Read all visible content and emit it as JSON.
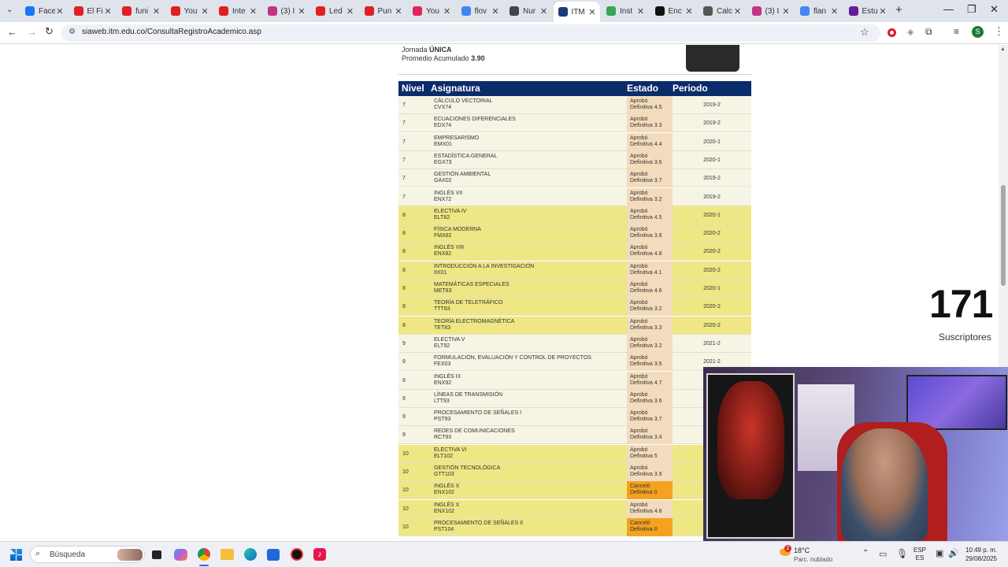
{
  "browser": {
    "tabs": [
      {
        "label": "Face",
        "color": "#1877f2"
      },
      {
        "label": "El Fi",
        "color": "#e02020"
      },
      {
        "label": "funi",
        "color": "#e02020"
      },
      {
        "label": "You",
        "color": "#e02020"
      },
      {
        "label": "Inte",
        "color": "#e02020"
      },
      {
        "label": "(3) I",
        "color": "#c13584"
      },
      {
        "label": "Led",
        "color": "#e02020"
      },
      {
        "label": "Pun",
        "color": "#e02020"
      },
      {
        "label": "You",
        "color": "#e0245e"
      },
      {
        "label": "flov",
        "color": "#4285f4"
      },
      {
        "label": "Nur",
        "color": "#444444"
      },
      {
        "label": "ITM",
        "color": "#1a3d7a"
      },
      {
        "label": "Inst",
        "color": "#34a853"
      },
      {
        "label": "Enc",
        "color": "#111111"
      },
      {
        "label": "Calc",
        "color": "#555555"
      },
      {
        "label": "(3) I",
        "color": "#c13584"
      },
      {
        "label": "flan",
        "color": "#4285f4"
      },
      {
        "label": "Estu",
        "color": "#6a1b9a"
      }
    ],
    "new_tab": "+",
    "minimize": "—",
    "restore": "❐",
    "close": "✕",
    "url": "siaweb.itm.edu.co/ConsultaRegistroAcademico.asp",
    "profile_initial": "S"
  },
  "student": {
    "jornada_label": "Jornada",
    "jornada_value": "ÚNICA",
    "promedio_label": "Promedio Acumulado",
    "promedio_value": "3.90"
  },
  "table": {
    "headers": {
      "nivel": "Nivel",
      "asignatura": "Asignatura",
      "estado": "Estado",
      "periodo": "Periodo"
    },
    "rows": [
      {
        "nivel": "7",
        "name": "CÁLCULO VECTORIAL",
        "code": "CVX74",
        "estado": "Aprobó",
        "nota": "Definitiva 4.5",
        "periodo": "2019-2",
        "status": "ok"
      },
      {
        "nivel": "7",
        "name": "ECUACIONES DIFERENCIALES",
        "code": "EDX74",
        "estado": "Aprobó",
        "nota": "Definitiva 3.3",
        "periodo": "2019-2",
        "status": "ok"
      },
      {
        "nivel": "7",
        "name": "EMPRESARISMO",
        "code": "EMX01",
        "estado": "Aprobó",
        "nota": "Definitiva 4.4",
        "periodo": "2020-1",
        "status": "ok"
      },
      {
        "nivel": "7",
        "name": "ESTADÍSTICA GENERAL",
        "code": "EGX73",
        "estado": "Aprobó",
        "nota": "Definitiva 3.6",
        "periodo": "2020-1",
        "status": "ok"
      },
      {
        "nivel": "7",
        "name": "GESTIÓN AMBIENTAL",
        "code": "GAX02",
        "estado": "Aprobó",
        "nota": "Definitiva 3.7",
        "periodo": "2019-2",
        "status": "ok"
      },
      {
        "nivel": "7",
        "name": "INGLÉS VII",
        "code": "ENX72",
        "estado": "Aprobó",
        "nota": "Definitiva 3.2",
        "periodo": "2019-2",
        "status": "ok"
      },
      {
        "nivel": "8",
        "name": "ELECTIVA IV",
        "code": "ELT82",
        "estado": "Aprobó",
        "nota": "Definitiva 4.5",
        "periodo": "2020-1",
        "status": "ok"
      },
      {
        "nivel": "8",
        "name": "FÍSICA MODERNA",
        "code": "FMX82",
        "estado": "Aprobó",
        "nota": "Definitiva 3.8",
        "periodo": "2020-2",
        "status": "ok"
      },
      {
        "nivel": "8",
        "name": "INGLÉS VIII",
        "code": "ENX82",
        "estado": "Aprobó",
        "nota": "Definitiva 4.8",
        "periodo": "2020-2",
        "status": "ok"
      },
      {
        "nivel": "8",
        "name": "INTRODUCCIÓN A LA INVESTIGACIÓN",
        "code": "IIX01",
        "estado": "Aprobó",
        "nota": "Definitiva 4.1",
        "periodo": "2020-2",
        "status": "ok"
      },
      {
        "nivel": "8",
        "name": "MATEMÁTICAS ESPECIALES",
        "code": "MET83",
        "estado": "Aprobó",
        "nota": "Definitiva 4.6",
        "periodo": "2020-1",
        "status": "ok"
      },
      {
        "nivel": "8",
        "name": "TEORÍA DE TELETRÁFICO",
        "code": "TTT83",
        "estado": "Aprobó",
        "nota": "Definitiva 3.2",
        "periodo": "2020-2",
        "status": "ok"
      },
      {
        "nivel": "8",
        "name": "TEORÍA ELECTROMAGNÉTICA",
        "code": "TET83",
        "estado": "Aprobó",
        "nota": "Definitiva 3.3",
        "periodo": "2020-2",
        "status": "ok"
      },
      {
        "nivel": "9",
        "name": "ELECTIVA V",
        "code": "ELT92",
        "estado": "Aprobó",
        "nota": "Definitiva 3.2",
        "periodo": "2021-2",
        "status": "ok"
      },
      {
        "nivel": "9",
        "name": "FORMULACIÓN, EVALUACIÓN Y CONTROL DE PROYECTOS",
        "code": "FEX03",
        "estado": "Aprobó",
        "nota": "Definitiva 3.5",
        "periodo": "2021-2",
        "status": "ok"
      },
      {
        "nivel": "9",
        "name": "INGLÉS IX",
        "code": "ENX92",
        "estado": "Aprobó",
        "nota": "Definitiva 4.7",
        "periodo": "",
        "status": "ok"
      },
      {
        "nivel": "9",
        "name": "LÍNEAS DE TRANSMISIÓN",
        "code": "LTT93",
        "estado": "Aprobó",
        "nota": "Definitiva 3.6",
        "periodo": "",
        "status": "ok"
      },
      {
        "nivel": "9",
        "name": "PROCESAMIENTO DE SEÑALES I",
        "code": "PST93",
        "estado": "Aprobó",
        "nota": "Definitiva 3.7",
        "periodo": "",
        "status": "ok"
      },
      {
        "nivel": "9",
        "name": "REDES DE COMUNICACIONES",
        "code": "RCT93",
        "estado": "Aprobó",
        "nota": "Definitiva 3.4",
        "periodo": "",
        "status": "ok"
      },
      {
        "nivel": "10",
        "name": "ELECTIVA VI",
        "code": "ELT102",
        "estado": "Aprobó",
        "nota": "Definitiva 5",
        "periodo": "",
        "status": "ok"
      },
      {
        "nivel": "10",
        "name": "GESTIÓN TECNOLÓGICA",
        "code": "GTT103",
        "estado": "Aprobó",
        "nota": "Definitiva 3.9",
        "periodo": "",
        "status": "ok"
      },
      {
        "nivel": "10",
        "name": "INGLÉS X",
        "code": "ENX102",
        "estado": "Canceló",
        "nota": "Definitiva 0",
        "periodo": "",
        "status": "cancel"
      },
      {
        "nivel": "10",
        "name": "INGLÉS X",
        "code": "ENX102",
        "estado": "Aprobó",
        "nota": "Definitiva 4.8",
        "periodo": "",
        "status": "ok"
      },
      {
        "nivel": "10",
        "name": "PROCESAMIENTO DE SEÑALES II",
        "code": "PST104",
        "estado": "Canceló",
        "nota": "Definitiva 0",
        "periodo": "",
        "status": "cancel"
      }
    ]
  },
  "overlay": {
    "subscriber_count": "171",
    "subscriber_label": "Suscriptores"
  },
  "taskbar": {
    "search_placeholder": "Búsqueda",
    "weather_temp": "18°C",
    "weather_desc": "Parc. nublado",
    "weather_badge": "2",
    "lang_top": "ESP",
    "lang_bottom": "ES",
    "time": "10:49 p. m.",
    "date": "29/08/2025"
  },
  "colors": {
    "header_bg": "#0b2c6b",
    "row_odd_level": "#f6f4e4",
    "row_even_level": "#efe784",
    "estado_ok": "#f3dcbd",
    "estado_cancel": "#f4a21f"
  }
}
